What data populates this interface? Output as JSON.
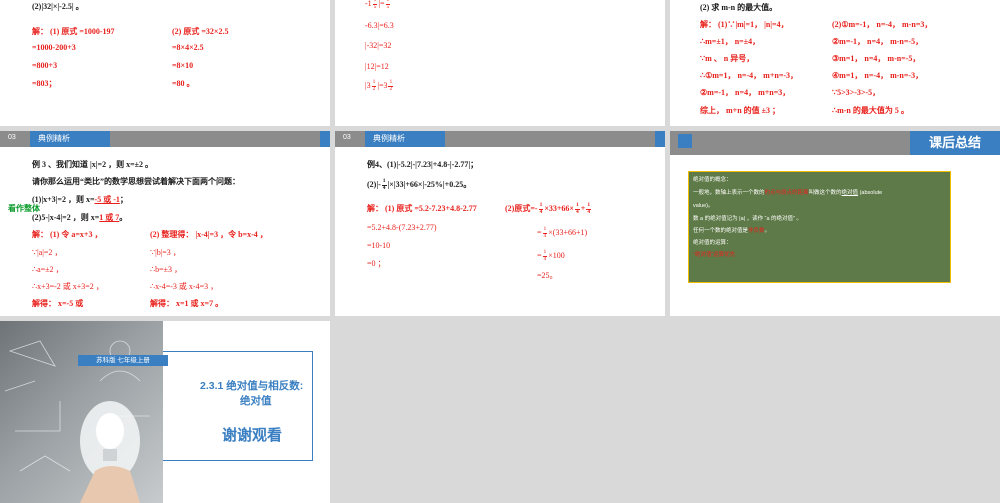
{
  "slide1": {
    "q": "(2)|32|×|-2.5| 。",
    "left": [
      "解： (1) 原式 =1000-197",
      "=1000-200+3",
      "=800+3",
      "=803；"
    ],
    "right": [
      "(2) 原式 =32×2.5",
      "=8×4×2.5",
      "=8×10",
      "=80 。"
    ]
  },
  "slide2": {
    "lines": [
      "-6.3|=6.3",
      "|-32|=32",
      "|12|=12"
    ],
    "frac_top": [
      "-1",
      "1",
      "5",
      "5"
    ],
    "frac_bottom": [
      "|3",
      "1",
      "2",
      "=3",
      "1",
      "2"
    ]
  },
  "slide3": {
    "q": "(2) 求 m-n 的最大值。",
    "left": [
      "解： (1)∵|m|=1， |n|=4，",
      "∴m=±1， n=±4，",
      "∵m 、 n 异号，",
      "∴①m=1， n=-4， m+n=-3，",
      "②m=-1， n=4， m+n=3，",
      "综上， m+n 的值 ±3 ；"
    ],
    "right": [
      "(2)①m=-1， n=-4， m-n=3，",
      "②m=-1， n=4， m-n=-5，",
      "③m=1， n=4， m-n=-5，",
      "④m=1， n=-4， m-n=-3，",
      "∵5>3>-3>-5，",
      "∴m-n 的最大值为 5 。"
    ]
  },
  "slide4": {
    "num": "03",
    "tag": "典例精析",
    "intro": [
      "例 3 、我们知道 |x|=2 ，则 x=±2 。",
      "请你那么运用“类比”的数学思想尝试着解决下面两个问题："
    ],
    "p1_pre": "(1)|x+3|=2 ，则 x=",
    "p1_ans": "-5 或 -1",
    "p1_post": "；",
    "badge": "看作整体",
    "p2_pre": "(2)5-|x-4|=2 ，则 x=",
    "p2_ans": "1 或 7",
    "p2_post": "。",
    "left": [
      "解： (1) 令 a=x+3 ，",
      "∵|a|=2 ，",
      "∴a=±2 ，",
      "∴x+3=-2 或 x+3=2 ，",
      "解得： x=-5 或"
    ],
    "right": [
      "(2) 整理得： |x-4|=3 ，令 b=x-4 ，",
      "∵|b|=3 ，",
      "∴b=±3 ，",
      "∴x-4=-3 或 x-4=3 ，",
      "解得： x=1 或 x=7 。"
    ]
  },
  "slide5": {
    "num": "03",
    "tag": "典例精析",
    "q1": "例4、(1)|-5.2|-|7.23|+4.8-|-2.77|；",
    "q2_pre": "(2)|-",
    "q2_post": "|×|33|+66×|-25%|+0.25。",
    "left": [
      "解： (1) 原式 =5.2-7.23+4.8-2.77",
      "=5.2+4.8-(7.23+2.77)",
      "=10-10",
      "=0 ；"
    ],
    "right_head": "(2)原式=",
    "right": [
      "×(33+66+1)",
      "×100",
      "=25。"
    ],
    "f_n": "1",
    "f_d": "4",
    "r1_mid": "×33+66×",
    "r1_plus": "+"
  },
  "slide6": {
    "title": "课后总结",
    "box_lines": [
      "绝对值的概念：",
      "一般地，数轴上表示一个数的",
      "的点与原点的距离",
      "叫做这个数的",
      "绝对值",
      "(absolute",
      "value)。",
      "数 a 的绝对值记为 |a| ，读作 “a 的绝对值” 。",
      "任何一个数的绝对值是",
      "非负数",
      "。",
      "绝对值的运算：",
      "“绝对值”运算优先"
    ]
  },
  "slide7": {
    "publisher": "苏科版 七年级上册",
    "lesson": "2.3.1 绝对值与相反数:",
    "sub": "绝对值",
    "thanks": "谢谢观看"
  }
}
